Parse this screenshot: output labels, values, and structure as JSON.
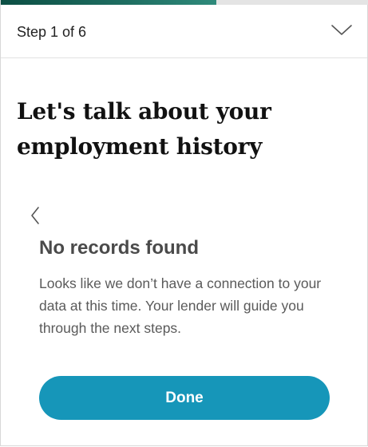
{
  "progress": {
    "fraction": 0.5857,
    "fill_color": "#1f6f62",
    "track_color": "#e4e4e4"
  },
  "header": {
    "step_label": "Step 1 of 6",
    "toggle_icon": "chevron-down-icon"
  },
  "main": {
    "title": "Let's talk about your employment history",
    "back_icon": "chevron-left-icon",
    "subtitle": "No records found",
    "message": "Looks like we don’t have a connection to your data at this time. Your lender will guide you through the next steps.",
    "done_label": "Done"
  },
  "colors": {
    "accent": "#1696b9"
  }
}
